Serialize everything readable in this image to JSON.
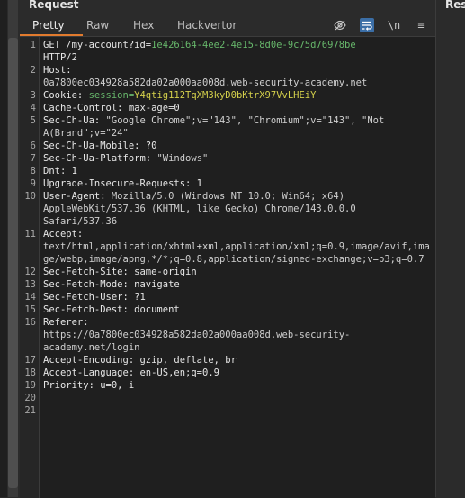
{
  "panel": {
    "title": "Request",
    "tabs": [
      "Pretty",
      "Raw",
      "Hex",
      "Hackvertor"
    ],
    "tool_icons": [
      "eye-off-icon",
      "wrap-icon",
      "newline-icon",
      "menu-icon"
    ],
    "tool_labels": {
      "newline": "\\n",
      "menu": "≡"
    }
  },
  "right_panel": {
    "title": "Resp"
  },
  "request": {
    "l1a": "GET /my-account?id=",
    "l1b": "1e426164-4ee2-4e15-8d0e-9c75d76978be",
    "l1c": "HTTP/2",
    "l2a": "Host: ",
    "l2b": "0a7800ec034928a582da02a000aa008d.web-security-academy.net",
    "l3a": "Cookie: ",
    "l3b": "session=",
    "l3c": "Y4qtig112TqXM3kyD0bKtrX97VvLHEiY",
    "l4": "Cache-Control: max-age=0",
    "l5a": "Sec-Ch-Ua: ",
    "l5b": "\"Google Chrome\";v=\"143\", \"Chromium\";v=\"143\", \"Not A(Brand\";v=\"24\"",
    "l6": "Sec-Ch-Ua-Mobile: ?0",
    "l7a": "Sec-Ch-Ua-Platform: ",
    "l7b": "\"Windows\"",
    "l8": "Dnt: 1",
    "l9": "Upgrade-Insecure-Requests: 1",
    "l10a": "User-Agent: ",
    "l10b": "Mozilla/5.0 (Windows NT 10.0; Win64; x64) AppleWebKit/537.36 (KHTML, like Gecko) Chrome/143.0.0.0 Safari/537.36",
    "l11a": "Accept:",
    "l11b": "text/html,application/xhtml+xml,application/xml;q=0.9,image/avif,image/webp,image/apng,*/*;q=0.8,application/signed-exchange;v=b3;q=0.7",
    "l12": "Sec-Fetch-Site: same-origin",
    "l13": "Sec-Fetch-Mode: navigate",
    "l14": "Sec-Fetch-User: ?1",
    "l15": "Sec-Fetch-Dest: document",
    "l16a": "Referer:",
    "l16b": "https://0a7800ec034928a582da02a000aa008d.web-security-academy.net/login",
    "l17": "Accept-Encoding: gzip, deflate, br",
    "l18": "Accept-Language: en-US,en;q=0.9",
    "l19": "Priority: u=0, i"
  },
  "line_numbers": [
    "1",
    "2",
    "3",
    "4",
    "5",
    "6",
    "7",
    "8",
    "9",
    "10",
    "11",
    "12",
    "13",
    "14",
    "15",
    "16",
    "17",
    "18",
    "19",
    "20",
    "21"
  ],
  "colors": {
    "accent": "#e27b2e",
    "green": "#67b76b",
    "yellow": "#d4d04b",
    "editor_bg": "#1f1f1f"
  }
}
